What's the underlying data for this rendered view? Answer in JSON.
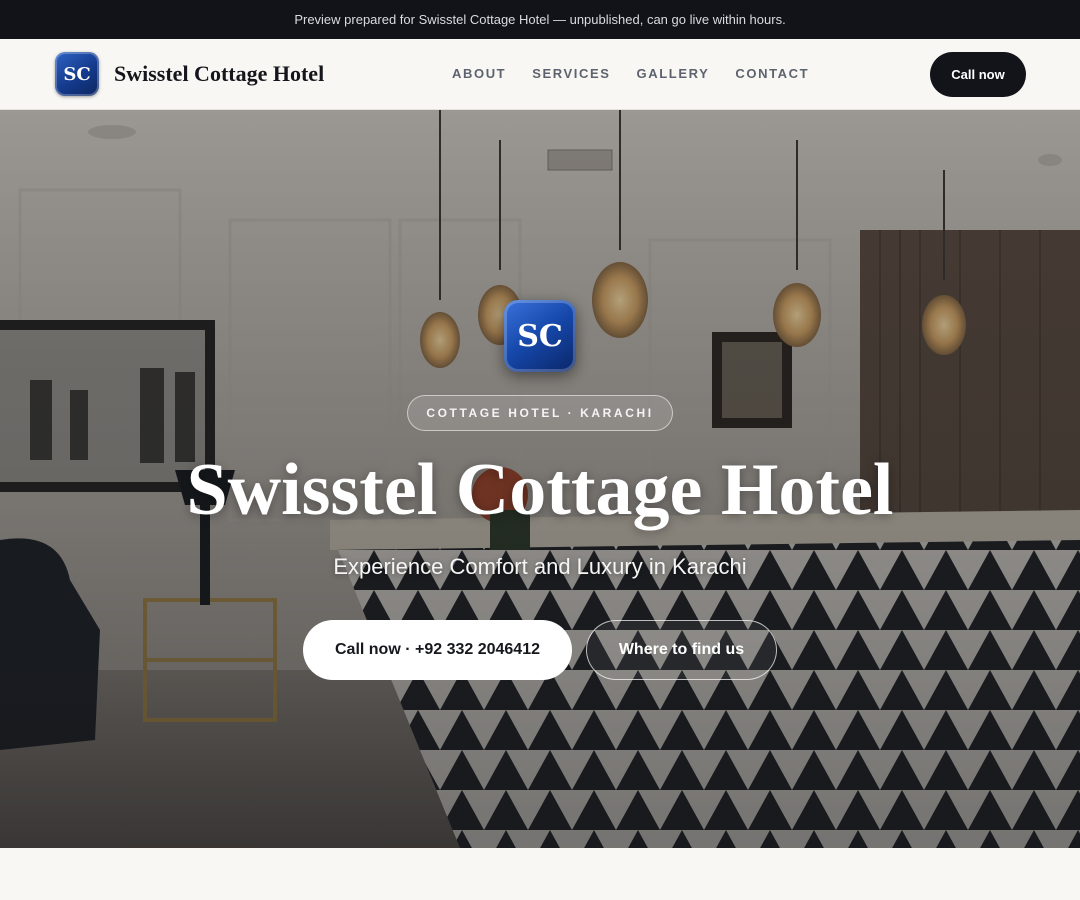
{
  "preview_banner": "Preview prepared for Swisstel Cottage Hotel — unpublished, can go live within hours.",
  "header": {
    "logo_initials": "SC",
    "brand_name": "Swisstel Cottage Hotel",
    "nav": [
      "ABOUT",
      "SERVICES",
      "GALLERY",
      "CONTACT"
    ],
    "call_button": "Call now"
  },
  "hero": {
    "logo_initials": "SC",
    "badge": "COTTAGE HOTEL · KARACHI",
    "title": "Swisstel Cottage Hotel",
    "subtitle": "Experience Comfort and Luxury in Karachi",
    "primary_button": "Call now · +92 332 2046412",
    "secondary_button": "Where to find us"
  },
  "colors": {
    "accent_blue": "#1546a8",
    "dark": "#121419",
    "background": "#f8f7f4"
  }
}
